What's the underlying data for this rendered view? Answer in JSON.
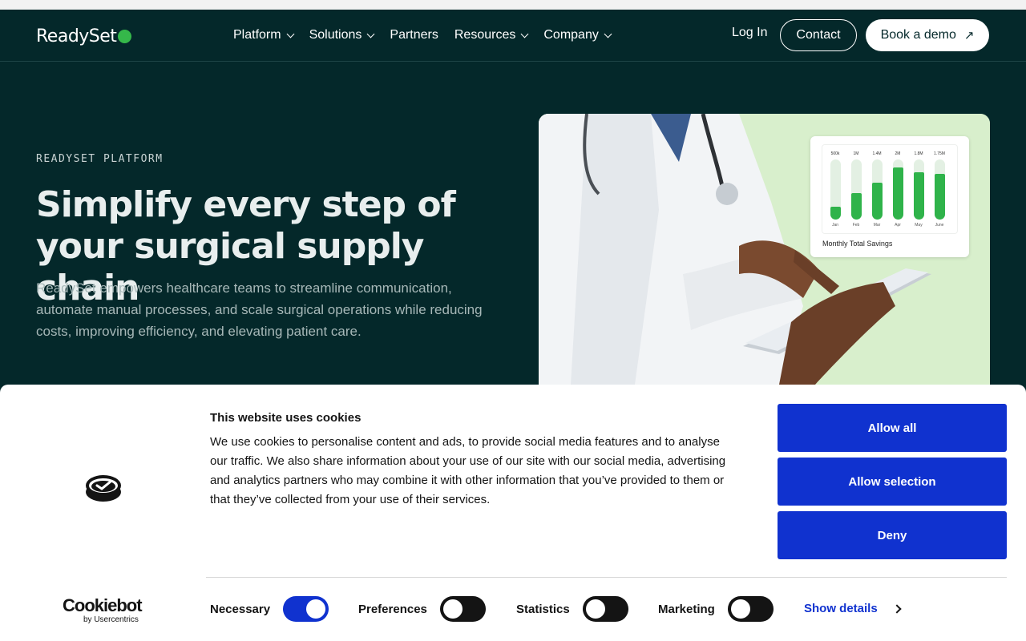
{
  "nav": {
    "logo_text": "ReadySet",
    "menu": [
      {
        "label": "Platform",
        "has_dropdown": true
      },
      {
        "label": "Solutions",
        "has_dropdown": true
      },
      {
        "label": "Partners",
        "has_dropdown": false
      },
      {
        "label": "Resources",
        "has_dropdown": true
      },
      {
        "label": "Company",
        "has_dropdown": true
      }
    ],
    "login": "Log In",
    "contact": "Contact",
    "demo": "Book a demo",
    "demo_icon": "arrow-up-right-icon",
    "accent": "#35b84a"
  },
  "hero": {
    "eyebrow": "READYSET PLATFORM",
    "title_line1": "Simplify every step of",
    "title_line2": "your surgical supply chain",
    "subtitle": "ReadySet empowers healthcare teams to streamline communication, automate manual processes, and scale surgical operations while reducing costs, improving efficiency, and elevating patient care."
  },
  "savings_card": {
    "title": "Monthly Total Savings",
    "bars": [
      {
        "month": "Jan",
        "value_label": "500k",
        "value": 0.5
      },
      {
        "month": "Feb",
        "value_label": "1M",
        "value": 1.0
      },
      {
        "month": "Mar",
        "value_label": "1.4M",
        "value": 1.4
      },
      {
        "month": "Apr",
        "value_label": "2M",
        "value": 2.0
      },
      {
        "month": "May",
        "value_label": "1.8M",
        "value": 1.8
      },
      {
        "month": "June",
        "value_label": "1.75M",
        "value": 1.75
      }
    ]
  },
  "cookie": {
    "title": "This website uses cookies",
    "text": "We use cookies to personalise content and ads, to provide social media features and to analyse our traffic. We also share information about your use of our site with our social media, advertising and analytics partners who may combine it with other information that you’ve provided to them or that they’ve collected from your use of their services.",
    "buttons": {
      "allow_all": "Allow all",
      "allow_selection": "Allow selection",
      "deny": "Deny"
    },
    "brand": "Cookiebot",
    "brand_by": "by Usercentrics",
    "toggles": [
      {
        "label": "Necessary",
        "on": true
      },
      {
        "label": "Preferences",
        "on": false
      },
      {
        "label": "Statistics",
        "on": false
      },
      {
        "label": "Marketing",
        "on": false
      }
    ],
    "show_details": "Show details",
    "button_color": "#1032cf"
  }
}
